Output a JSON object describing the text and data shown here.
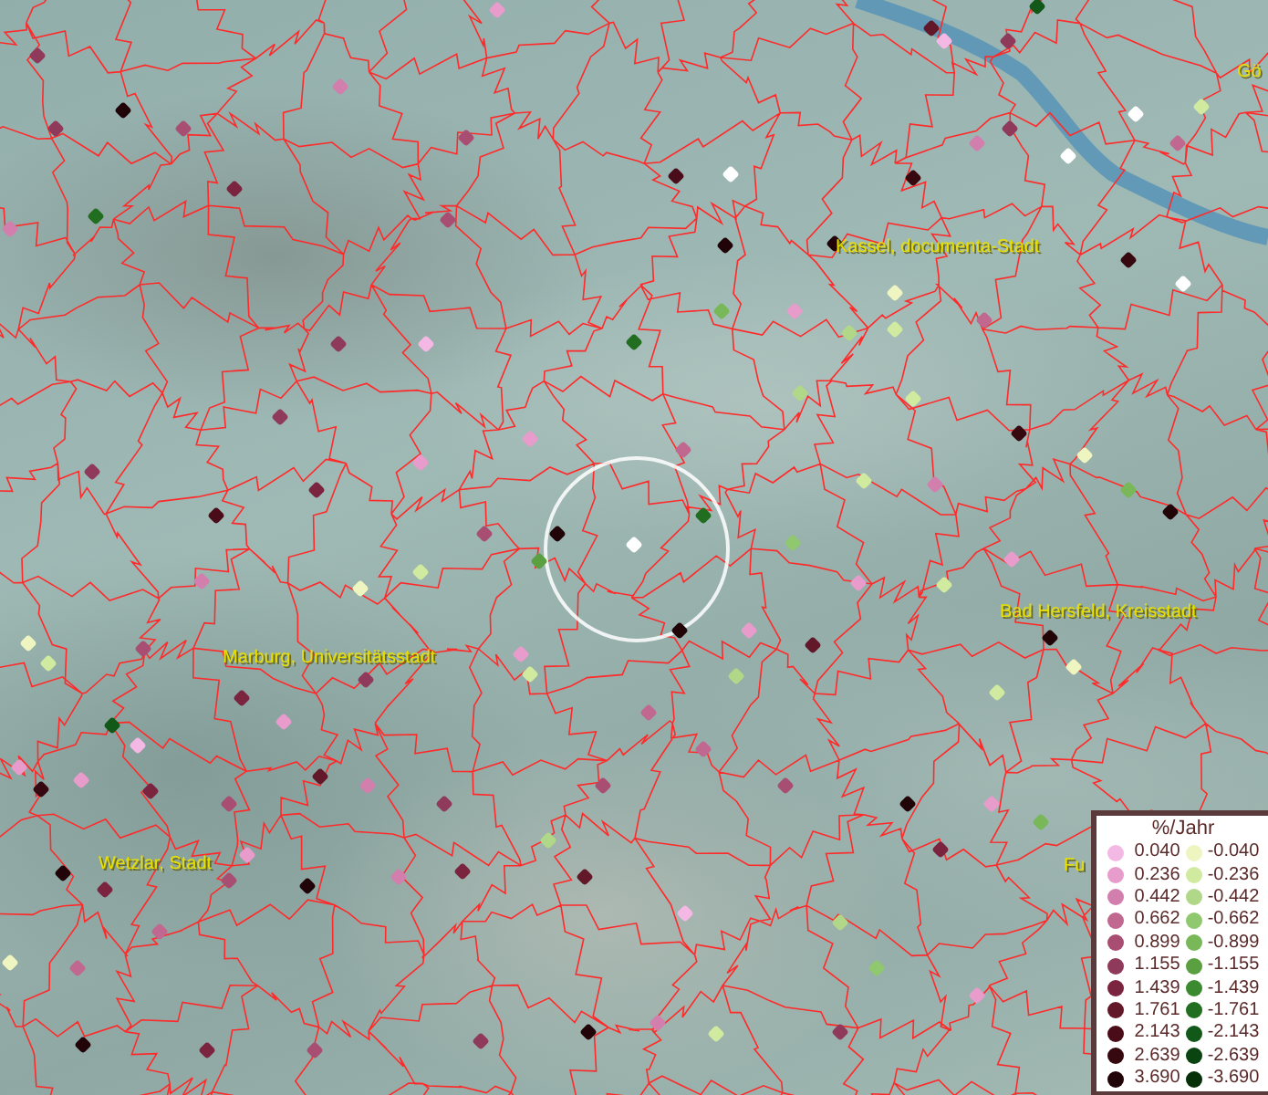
{
  "map": {
    "labels": [
      {
        "text": "Gö"
      },
      {
        "text": "Kassel, documenta-Stadt"
      },
      {
        "text": "Bad Hersfeld, Kreisstadt"
      },
      {
        "text": "Marburg, Universitätsstadt"
      },
      {
        "text": "Fu"
      },
      {
        "text": "Wetzlar, Stadt"
      }
    ],
    "markers": [
      {
        "color": "#8f3a5a"
      },
      {
        "color": "#200408"
      },
      {
        "color": "#d27fae"
      },
      {
        "color": "#226e20"
      },
      {
        "color": "#8f3a5a"
      },
      {
        "color": "#a84e72"
      },
      {
        "color": "#7a2440"
      },
      {
        "color": "#d27fae"
      },
      {
        "color": "#a84e72"
      },
      {
        "color": "#e79ccc"
      },
      {
        "color": "#a84e72"
      },
      {
        "color": "#8f3a5a"
      },
      {
        "color": "#f4b8e4"
      },
      {
        "color": "#8f3a5a"
      },
      {
        "color": "#e79ccc"
      },
      {
        "color": "#e79ccc"
      },
      {
        "color": "#8f3a5a"
      },
      {
        "color": "#7a2440"
      },
      {
        "color": "#4a0c18"
      },
      {
        "color": "#a84e72"
      },
      {
        "color": "#200408"
      },
      {
        "color": "#ffffff"
      },
      {
        "color": "#226e20"
      },
      {
        "color": "#5aa040"
      },
      {
        "color": "#200408"
      },
      {
        "color": "#d0eaa0"
      },
      {
        "color": "#eef5c0"
      },
      {
        "color": "#d27fae"
      },
      {
        "color": "#eef5c0"
      },
      {
        "color": "#d0eaa0"
      },
      {
        "color": "#a84e72"
      },
      {
        "color": "#7a2440"
      },
      {
        "color": "#8f3a5a"
      },
      {
        "color": "#e79ccc"
      },
      {
        "color": "#d0eaa0"
      },
      {
        "color": "#e79ccc"
      },
      {
        "color": "#125818"
      },
      {
        "color": "#f4b8e4"
      },
      {
        "color": "#e79ccc"
      },
      {
        "color": "#360810"
      },
      {
        "color": "#7a2440"
      },
      {
        "color": "#a84e72"
      },
      {
        "color": "#e79ccc"
      },
      {
        "color": "#d27fae"
      },
      {
        "color": "#621828"
      },
      {
        "color": "#e79ccc"
      },
      {
        "color": "#a84e72"
      },
      {
        "color": "#200408"
      },
      {
        "color": "#7a2440"
      },
      {
        "color": "#200408"
      },
      {
        "color": "#7a2440"
      },
      {
        "color": "#eef5c0"
      },
      {
        "color": "#c06890"
      },
      {
        "color": "#c06890"
      },
      {
        "color": "#200408"
      },
      {
        "color": "#7a2440"
      },
      {
        "color": "#a84e72"
      },
      {
        "color": "#8f3a5a"
      },
      {
        "color": "#200408"
      },
      {
        "color": "#f4b8e4"
      },
      {
        "color": "#621828"
      },
      {
        "color": "#d27fae"
      },
      {
        "color": "#8f3a5a"
      },
      {
        "color": "#226e20"
      },
      {
        "color": "#78b858"
      },
      {
        "color": "#c06890"
      },
      {
        "color": "#200408"
      },
      {
        "color": "#4a0c18"
      },
      {
        "color": "#ffffff"
      },
      {
        "color": "#e79ccc"
      },
      {
        "color": "#b0d888"
      },
      {
        "color": "#eef5c0"
      },
      {
        "color": "#200408"
      },
      {
        "color": "#360810"
      },
      {
        "color": "#d27fae"
      },
      {
        "color": "#8f3a5a"
      },
      {
        "color": "#ffffff"
      },
      {
        "color": "#ffffff"
      },
      {
        "color": "#d0eaa0"
      },
      {
        "color": "#c06890"
      },
      {
        "color": "#125818"
      },
      {
        "color": "#f4b8e4"
      },
      {
        "color": "#8f3a5a"
      },
      {
        "color": "#621828"
      },
      {
        "color": "#d0eaa0"
      },
      {
        "color": "#c06890"
      },
      {
        "color": "#360810"
      },
      {
        "color": "#ffffff"
      },
      {
        "color": "#b0d888"
      },
      {
        "color": "#d0eaa0"
      },
      {
        "color": "#d0eaa0"
      },
      {
        "color": "#d27fae"
      },
      {
        "color": "#360810"
      },
      {
        "color": "#eef5c0"
      },
      {
        "color": "#78b858"
      },
      {
        "color": "#200408"
      },
      {
        "color": "#e79ccc"
      },
      {
        "color": "#200408"
      },
      {
        "color": "#eef5c0"
      },
      {
        "color": "#d0eaa0"
      },
      {
        "color": "#d0eaa0"
      },
      {
        "color": "#90c870"
      },
      {
        "color": "#621828"
      },
      {
        "color": "#e79ccc"
      },
      {
        "color": "#200408"
      },
      {
        "color": "#7a2440"
      },
      {
        "color": "#e79ccc"
      },
      {
        "color": "#b0d888"
      },
      {
        "color": "#90c870"
      },
      {
        "color": "#e79ccc"
      },
      {
        "color": "#78b858"
      },
      {
        "color": "#e79ccc"
      },
      {
        "color": "#b0d888"
      },
      {
        "color": "#a84e72"
      },
      {
        "color": "#c06890"
      },
      {
        "color": "#c06890"
      },
      {
        "color": "#8f3a5a"
      },
      {
        "color": "#d0eaa0"
      },
      {
        "color": "#a84e72"
      },
      {
        "color": "#b0d888"
      },
      {
        "color": "#d27fae"
      }
    ]
  },
  "legend": {
    "title": "%/Jahr",
    "rows": [
      {
        "positive": {
          "value": "0.040",
          "color": "#f4b8e4"
        },
        "negative": {
          "value": "-0.040",
          "color": "#eef5c0"
        }
      },
      {
        "positive": {
          "value": "0.236",
          "color": "#e79ccc"
        },
        "negative": {
          "value": "-0.236",
          "color": "#d0eaa0"
        }
      },
      {
        "positive": {
          "value": "0.442",
          "color": "#d27fae"
        },
        "negative": {
          "value": "-0.442",
          "color": "#b0d888"
        }
      },
      {
        "positive": {
          "value": "0.662",
          "color": "#c06890"
        },
        "negative": {
          "value": "-0.662",
          "color": "#90c870"
        }
      },
      {
        "positive": {
          "value": "0.899",
          "color": "#a84e72"
        },
        "negative": {
          "value": "-0.899",
          "color": "#78b858"
        }
      },
      {
        "positive": {
          "value": "1.155",
          "color": "#8f3a5a"
        },
        "negative": {
          "value": "-1.155",
          "color": "#5aa040"
        }
      },
      {
        "positive": {
          "value": "1.439",
          "color": "#7a2440"
        },
        "negative": {
          "value": "-1.439",
          "color": "#3c8a30"
        }
      },
      {
        "positive": {
          "value": "1.761",
          "color": "#621828"
        },
        "negative": {
          "value": "-1.761",
          "color": "#226e20"
        }
      },
      {
        "positive": {
          "value": "2.143",
          "color": "#4a0c18"
        },
        "negative": {
          "value": "-2.143",
          "color": "#125818"
        }
      },
      {
        "positive": {
          "value": "2.639",
          "color": "#360810"
        },
        "negative": {
          "value": "-2.639",
          "color": "#0a4410"
        }
      },
      {
        "positive": {
          "value": "3.690",
          "color": "#200408"
        },
        "negative": {
          "value": "-3.690",
          "color": "#053008"
        }
      }
    ]
  }
}
